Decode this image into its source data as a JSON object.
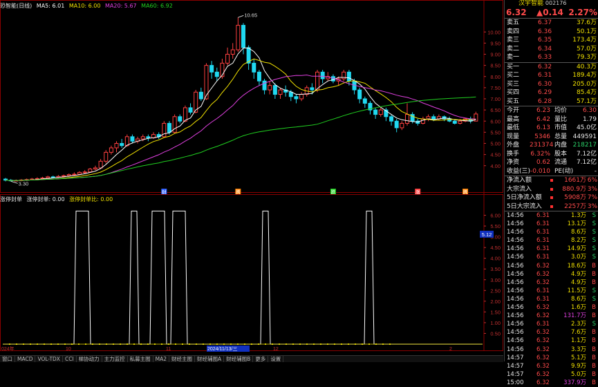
{
  "stock_title": "恐智能(日线)",
  "ma": [
    {
      "label": "MA5: 6.01",
      "color": "#ffffff"
    },
    {
      "label": "MA10: 6.00",
      "color": "#f0e000"
    },
    {
      "label": "MA20: 5.67",
      "color": "#e040e0"
    },
    {
      "label": "MA60: 6.92",
      "color": "#20d020"
    }
  ],
  "max_label": "10.65",
  "min_label": "3.30",
  "price_ticks": [
    "10.00",
    "9.50",
    "9.00",
    "8.50",
    "8.00",
    "7.50",
    "7.00",
    "6.50",
    "6.00",
    "5.50",
    "5.00",
    "4.50",
    "4.00"
  ],
  "ind_ticks": [
    "6.00",
    "5.50",
    "5.00",
    "4.50",
    "4.00",
    "3.50",
    "3.00",
    "2.50",
    "2.00",
    "1.50",
    "1.00",
    "0.50"
  ],
  "ind_badge": "5.12",
  "event_marks": [
    {
      "t": "财",
      "c": "#3060ff"
    },
    {
      "t": "腾",
      "c": "#ff8000"
    },
    {
      "t": "跌",
      "c": "#20d020"
    },
    {
      "t": "涨",
      "c": "#ff4040"
    },
    {
      "t": "腾",
      "c": "#ff8000"
    }
  ],
  "indicator_header": {
    "name": "涨停封单",
    "v1": "涨停封单: 0.00",
    "v2": "涨停封单比: 0.00"
  },
  "x_axis": [
    "024年",
    "10",
    "11",
    "2024/11/13/三",
    "12",
    "2"
  ],
  "tabs": [
    "窗口",
    "MACD",
    "VOL-TDX",
    "CCI",
    "梯协动力",
    "主力监控",
    "私募主图",
    "MA2",
    "财经主图",
    "财经辅图A",
    "财经辅图B",
    "更多",
    "设置"
  ],
  "header": {
    "name": "汉宇智能",
    "code": "002176",
    "price": "6.32",
    "change": "▲0.14",
    "pct": "2.27%"
  },
  "asks": [
    {
      "l": "卖五",
      "p": "6.37",
      "v": "37.6万"
    },
    {
      "l": "卖四",
      "p": "6.36",
      "v": "50.1万"
    },
    {
      "l": "卖三",
      "p": "6.35",
      "v": "173.4万"
    },
    {
      "l": "卖二",
      "p": "6.34",
      "v": "57.0万"
    },
    {
      "l": "卖一",
      "p": "6.33",
      "v": "79.3万"
    }
  ],
  "bids": [
    {
      "l": "买一",
      "p": "6.32",
      "v": "40.3万"
    },
    {
      "l": "买二",
      "p": "6.31",
      "v": "189.4万"
    },
    {
      "l": "买三",
      "p": "6.30",
      "v": "205.0万"
    },
    {
      "l": "买四",
      "p": "6.29",
      "v": "85.4万"
    },
    {
      "l": "买五",
      "p": "6.28",
      "v": "57.1万"
    }
  ],
  "stats": [
    {
      "a": "今开",
      "av": "6.23",
      "b": "均价",
      "bv": "6.30"
    },
    {
      "a": "最高",
      "av": "6.42",
      "b": "量比",
      "bv": "1.79"
    },
    {
      "a": "最低",
      "av": "6.13",
      "b": "市值",
      "bv": "45.0亿"
    },
    {
      "a": "现量",
      "av": "5346",
      "b": "总量",
      "bv": "449591"
    },
    {
      "a": "外盘",
      "av": "231374",
      "b": "内盘",
      "bv": "218217"
    },
    {
      "a": "换手",
      "av": "6.32%",
      "b": "股本",
      "bv": "7.12亿"
    },
    {
      "a": "净资",
      "av": "0.62",
      "b": "流通",
      "bv": "7.12亿"
    },
    {
      "a": "收益(三)",
      "av": "-0.010",
      "b": "PE(动)",
      "bv": "-"
    }
  ],
  "flows": [
    {
      "l": "净流入额",
      "v": "1661万",
      "p": "6%"
    },
    {
      "l": "大宗流入",
      "v": "880.9万",
      "p": "3%"
    },
    {
      "l": "5日净流入额",
      "v": "5908万",
      "p": "7%"
    },
    {
      "l": "5日大宗流入",
      "v": "2257万",
      "p": "3%"
    }
  ],
  "trades": [
    {
      "t": "14:56",
      "p": "6.31",
      "v": "1.3万",
      "s": "S"
    },
    {
      "t": "14:56",
      "p": "6.31",
      "v": "13.1万",
      "s": "S"
    },
    {
      "t": "14:56",
      "p": "6.31",
      "v": "8.6万",
      "s": "S"
    },
    {
      "t": "14:56",
      "p": "6.31",
      "v": "8.2万",
      "s": "S"
    },
    {
      "t": "14:56",
      "p": "6.31",
      "v": "14.9万",
      "s": "S"
    },
    {
      "t": "14:56",
      "p": "6.31",
      "v": "3.0万",
      "s": "S"
    },
    {
      "t": "14:56",
      "p": "6.32",
      "v": "18.6万",
      "s": "B"
    },
    {
      "t": "14:56",
      "p": "6.32",
      "v": "4.9万",
      "s": "B"
    },
    {
      "t": "14:56",
      "p": "6.32",
      "v": "4.9万",
      "s": "B"
    },
    {
      "t": "14:56",
      "p": "6.31",
      "v": "11.5万",
      "s": "S"
    },
    {
      "t": "14:56",
      "p": "6.31",
      "v": "8.6万",
      "s": "S"
    },
    {
      "t": "14:56",
      "p": "6.32",
      "v": "1.6万",
      "s": "B"
    },
    {
      "t": "14:56",
      "p": "6.32",
      "v": "131.7万",
      "s": "B"
    },
    {
      "t": "14:56",
      "p": "6.31",
      "v": "2.3万",
      "s": "S"
    },
    {
      "t": "14:56",
      "p": "6.32",
      "v": "7.6万",
      "s": "B"
    },
    {
      "t": "14:56",
      "p": "6.32",
      "v": "1.1万",
      "s": "B"
    },
    {
      "t": "14:56",
      "p": "6.32",
      "v": "3.3万",
      "s": "B"
    },
    {
      "t": "14:57",
      "p": "6.32",
      "v": "5.1万",
      "s": "B"
    },
    {
      "t": "14:57",
      "p": "6.32",
      "v": "9.9万",
      "s": "B"
    },
    {
      "t": "14:57",
      "p": "6.32",
      "v": "5.0万",
      "s": "B"
    },
    {
      "t": "15:00",
      "p": "6.32",
      "v": "337.9万",
      "s": "B"
    }
  ],
  "chart_data": {
    "type": "candlestick",
    "ylim": [
      3.0,
      11.0
    ],
    "candles": [
      [
        3.4,
        3.35,
        3.45,
        3.3
      ],
      [
        3.35,
        3.32,
        3.4,
        3.3
      ],
      [
        3.32,
        3.34,
        3.38,
        3.3
      ],
      [
        3.34,
        3.36,
        3.4,
        3.3
      ],
      [
        3.36,
        3.38,
        3.42,
        3.32
      ],
      [
        3.38,
        3.4,
        3.45,
        3.35
      ],
      [
        3.4,
        3.42,
        3.48,
        3.36
      ],
      [
        3.42,
        3.45,
        3.5,
        3.4
      ],
      [
        3.45,
        3.5,
        3.55,
        3.42
      ],
      [
        3.5,
        3.48,
        3.55,
        3.44
      ],
      [
        3.48,
        3.52,
        3.58,
        3.45
      ],
      [
        3.52,
        3.55,
        3.6,
        3.48
      ],
      [
        3.55,
        3.6,
        3.65,
        3.5
      ],
      [
        3.6,
        3.62,
        3.7,
        3.55
      ],
      [
        3.62,
        3.7,
        3.75,
        3.58
      ],
      [
        3.7,
        3.72,
        3.8,
        3.65
      ],
      [
        3.72,
        3.85,
        3.9,
        3.7
      ],
      [
        3.85,
        3.9,
        4.0,
        3.8
      ],
      [
        3.9,
        4.2,
        4.3,
        3.85
      ],
      [
        4.2,
        4.6,
        4.7,
        4.1
      ],
      [
        4.6,
        4.8,
        4.9,
        4.5
      ],
      [
        4.8,
        5.0,
        5.1,
        4.6
      ],
      [
        5.0,
        4.9,
        5.2,
        4.8
      ],
      [
        4.9,
        5.3,
        5.4,
        4.85
      ],
      [
        5.3,
        5.1,
        5.4,
        5.0
      ],
      [
        5.1,
        5.2,
        5.3,
        5.0
      ],
      [
        5.2,
        5.3,
        5.4,
        5.1
      ],
      [
        5.3,
        5.25,
        5.4,
        5.1
      ],
      [
        5.25,
        5.4,
        5.5,
        5.2
      ],
      [
        5.4,
        5.3,
        5.5,
        5.2
      ],
      [
        5.3,
        5.9,
        6.0,
        5.25
      ],
      [
        5.9,
        5.5,
        6.0,
        5.4
      ],
      [
        5.5,
        6.2,
        6.3,
        5.45
      ],
      [
        6.2,
        6.0,
        6.3,
        5.9
      ],
      [
        6.0,
        6.6,
        6.7,
        5.95
      ],
      [
        6.6,
        6.4,
        6.8,
        6.3
      ],
      [
        6.4,
        7.3,
        7.4,
        6.35
      ],
      [
        7.3,
        7.0,
        7.5,
        6.9
      ],
      [
        7.0,
        8.5,
        8.6,
        6.95
      ],
      [
        8.5,
        8.2,
        8.7,
        7.9
      ],
      [
        8.2,
        8.0,
        8.4,
        7.8
      ],
      [
        8.0,
        8.6,
        8.8,
        7.9
      ],
      [
        8.6,
        9.0,
        9.3,
        8.5
      ],
      [
        9.0,
        9.2,
        9.5,
        8.8
      ],
      [
        9.2,
        10.3,
        10.65,
        9.1
      ],
      [
        10.3,
        9.3,
        10.4,
        9.0
      ],
      [
        9.3,
        8.6,
        9.4,
        8.3
      ],
      [
        8.6,
        8.2,
        8.8,
        7.9
      ],
      [
        8.2,
        7.8,
        8.3,
        7.6
      ],
      [
        7.8,
        7.4,
        7.9,
        7.2
      ],
      [
        7.4,
        7.6,
        7.8,
        7.2
      ],
      [
        7.6,
        7.2,
        7.7,
        7.0
      ],
      [
        7.2,
        7.4,
        7.5,
        7.0
      ],
      [
        7.4,
        7.3,
        7.6,
        7.1
      ],
      [
        7.3,
        7.1,
        7.4,
        6.9
      ],
      [
        7.1,
        7.0,
        7.2,
        6.8
      ],
      [
        7.0,
        7.2,
        7.3,
        6.9
      ],
      [
        7.2,
        7.5,
        7.6,
        7.1
      ],
      [
        7.5,
        7.4,
        7.7,
        7.2
      ],
      [
        7.4,
        8.2,
        8.3,
        7.3
      ],
      [
        8.2,
        7.9,
        8.3,
        7.7
      ],
      [
        7.9,
        8.0,
        8.2,
        7.8
      ],
      [
        8.0,
        7.8,
        8.1,
        7.7
      ],
      [
        7.8,
        7.9,
        8.0,
        7.6
      ],
      [
        7.9,
        8.2,
        8.3,
        7.8
      ],
      [
        8.2,
        7.8,
        8.3,
        7.6
      ],
      [
        7.8,
        7.4,
        7.9,
        7.2
      ],
      [
        7.4,
        7.0,
        7.5,
        6.8
      ],
      [
        7.0,
        6.8,
        7.1,
        6.6
      ],
      [
        6.8,
        6.5,
        6.9,
        6.3
      ],
      [
        6.5,
        6.3,
        6.6,
        6.1
      ],
      [
        6.3,
        6.5,
        6.6,
        6.2
      ],
      [
        6.5,
        6.2,
        6.6,
        6.0
      ],
      [
        6.2,
        6.0,
        6.3,
        5.8
      ],
      [
        6.0,
        5.7,
        6.1,
        5.5
      ],
      [
        5.7,
        5.9,
        6.0,
        5.6
      ],
      [
        5.9,
        6.3,
        6.8,
        5.8
      ],
      [
        6.3,
        6.0,
        6.4,
        5.9
      ],
      [
        6.0,
        5.9,
        6.1,
        5.8
      ],
      [
        5.9,
        6.1,
        6.2,
        5.85
      ],
      [
        6.1,
        6.2,
        6.3,
        6.0
      ],
      [
        6.2,
        6.1,
        6.3,
        6.0
      ],
      [
        6.1,
        6.2,
        6.3,
        6.05
      ],
      [
        6.2,
        6.1,
        6.25,
        6.0
      ],
      [
        6.1,
        6.0,
        6.2,
        5.95
      ],
      [
        6.0,
        5.9,
        6.05,
        5.85
      ],
      [
        5.9,
        6.0,
        6.1,
        5.85
      ],
      [
        6.0,
        6.1,
        6.15,
        5.95
      ],
      [
        6.1,
        6.0,
        6.2,
        5.9
      ],
      [
        6.0,
        6.32,
        6.42,
        6.13
      ]
    ],
    "indicator": {
      "ylim": [
        0,
        6.5
      ],
      "spikes": [
        10,
        18,
        21,
        24,
        37,
        52
      ]
    }
  }
}
